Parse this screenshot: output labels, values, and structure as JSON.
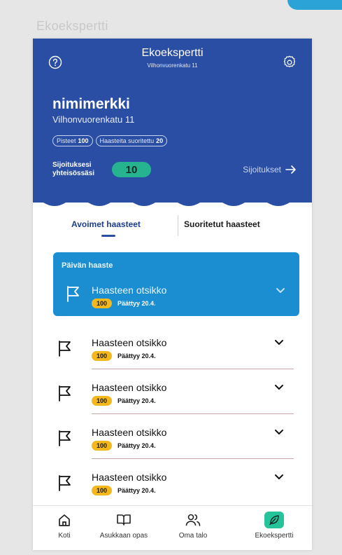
{
  "outer_title": "Ekoekspertti",
  "header": {
    "app_name": "Ekoekspertti",
    "address": "Vilhonvuorenkatu 11",
    "help_icon": "help-circle-icon",
    "settings_icon": "gear-icon",
    "color": "#2a4ea4"
  },
  "profile": {
    "nickname": "nimimerkki",
    "address": "Vilhonvuorenkatu 11",
    "points_label": "Pisteet",
    "points_value": "100",
    "completed_label": "Haasteita suoritettu",
    "completed_value": "20"
  },
  "ranking": {
    "label_line1": "Sijoituksesi",
    "label_line2": "yhteisössäsi",
    "value": "10",
    "link_label": "Sijoitukset",
    "badge_color": "#25b48f"
  },
  "tabs": [
    {
      "label": "Avoimet haasteet",
      "active": true
    },
    {
      "label": "Suoritetut haasteet",
      "active": false
    }
  ],
  "daily": {
    "label": "Päivän haaste",
    "title": "Haasteen otsikko",
    "points": "100",
    "due": "Päättyy 20.4.",
    "color": "#1a8ed0"
  },
  "challenges": [
    {
      "title": "Haasteen otsikko",
      "points": "100",
      "due": "Päättyy 20.4."
    },
    {
      "title": "Haasteen otsikko",
      "points": "100",
      "due": "Päättyy 20.4."
    },
    {
      "title": "Haasteen otsikko",
      "points": "100",
      "due": "Päättyy 20.4."
    },
    {
      "title": "Haasteen otsikko",
      "points": "100",
      "due": "Päättyy 20.4."
    }
  ],
  "bottom_nav": [
    {
      "label": "Koti",
      "icon": "home-icon"
    },
    {
      "label": "Asukkaan opas",
      "icon": "book-icon"
    },
    {
      "label": "Oma talo",
      "icon": "users-icon"
    },
    {
      "label": "Ekoekspertti",
      "icon": "leaf-icon",
      "active": true
    }
  ],
  "accent_green": "#25c39a",
  "points_color": "#f4b71c"
}
